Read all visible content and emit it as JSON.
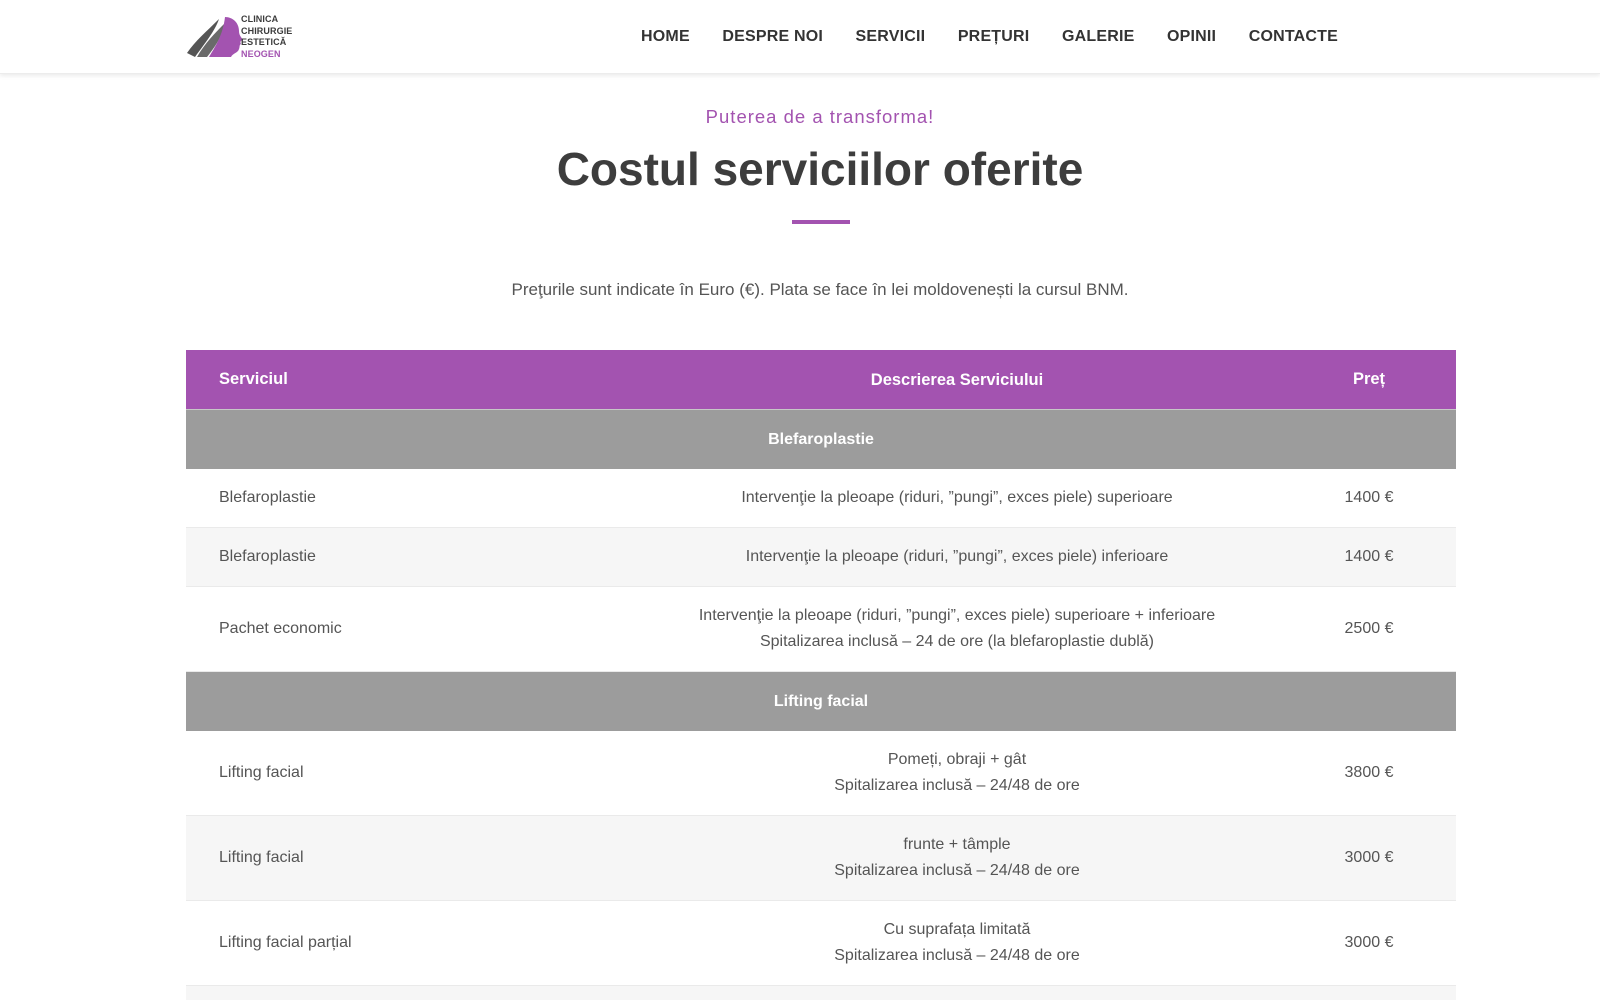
{
  "header": {
    "logo": {
      "line1": "CLINICA",
      "line2": "CHIRURGIE",
      "line3": "ESTETICĂ",
      "line4": "NEOGEN"
    },
    "nav": [
      "HOME",
      "DESPRE NOI",
      "SERVICII",
      "PREȚURI",
      "GALERIE",
      "OPINII",
      "CONTACTE"
    ]
  },
  "hero": {
    "eyebrow": "Puterea de a transforma!",
    "title": "Costul serviciilor oferite",
    "note": "Preţurile sunt indicate în Euro (€). Plata se face în lei moldovenești la cursul BNM."
  },
  "table": {
    "headers": {
      "service": "Serviciul",
      "description": "Descrierea Serviciului",
      "price": "Preț"
    },
    "sections": [
      {
        "category": "Blefaroplastie",
        "rows": [
          {
            "service": "Blefaroplastie",
            "desc1": "Intervenţie la pleoape (riduri, ”pungi”, exces piele) superioare",
            "desc2": "",
            "price": "1400 €"
          },
          {
            "service": "Blefaroplastie",
            "desc1": "Intervenţie la pleoape (riduri, ”pungi”, exces piele) inferioare",
            "desc2": "",
            "price": "1400 €"
          },
          {
            "service": "Pachet economic",
            "desc1": "Intervenţie la pleoape (riduri, ”pungi”, exces piele) superioare + inferioare",
            "desc2": "Spitalizarea inclusă – 24 de ore (la blefaroplastie dublă)",
            "price": "2500 €"
          }
        ]
      },
      {
        "category": "Lifting facial",
        "rows": [
          {
            "service": "Lifting facial",
            "desc1": "Pomeți, obraji + gât",
            "desc2": "Spitalizarea inclusă – 24/48 de ore",
            "price": "3800 €"
          },
          {
            "service": "Lifting facial",
            "desc1": "frunte + tâmple",
            "desc2": "Spitalizarea inclusă – 24/48 de ore",
            "price": "3000 €"
          },
          {
            "service": "Lifting facial parțial",
            "desc1": "Cu suprafața limitată",
            "desc2": "Spitalizarea inclusă – 24/48 de ore",
            "price": "3000 €"
          }
        ]
      }
    ]
  },
  "colors": {
    "accent": "#a353b0",
    "category_bg": "#9c9c9c",
    "alt_row": "#f6f6f6"
  }
}
